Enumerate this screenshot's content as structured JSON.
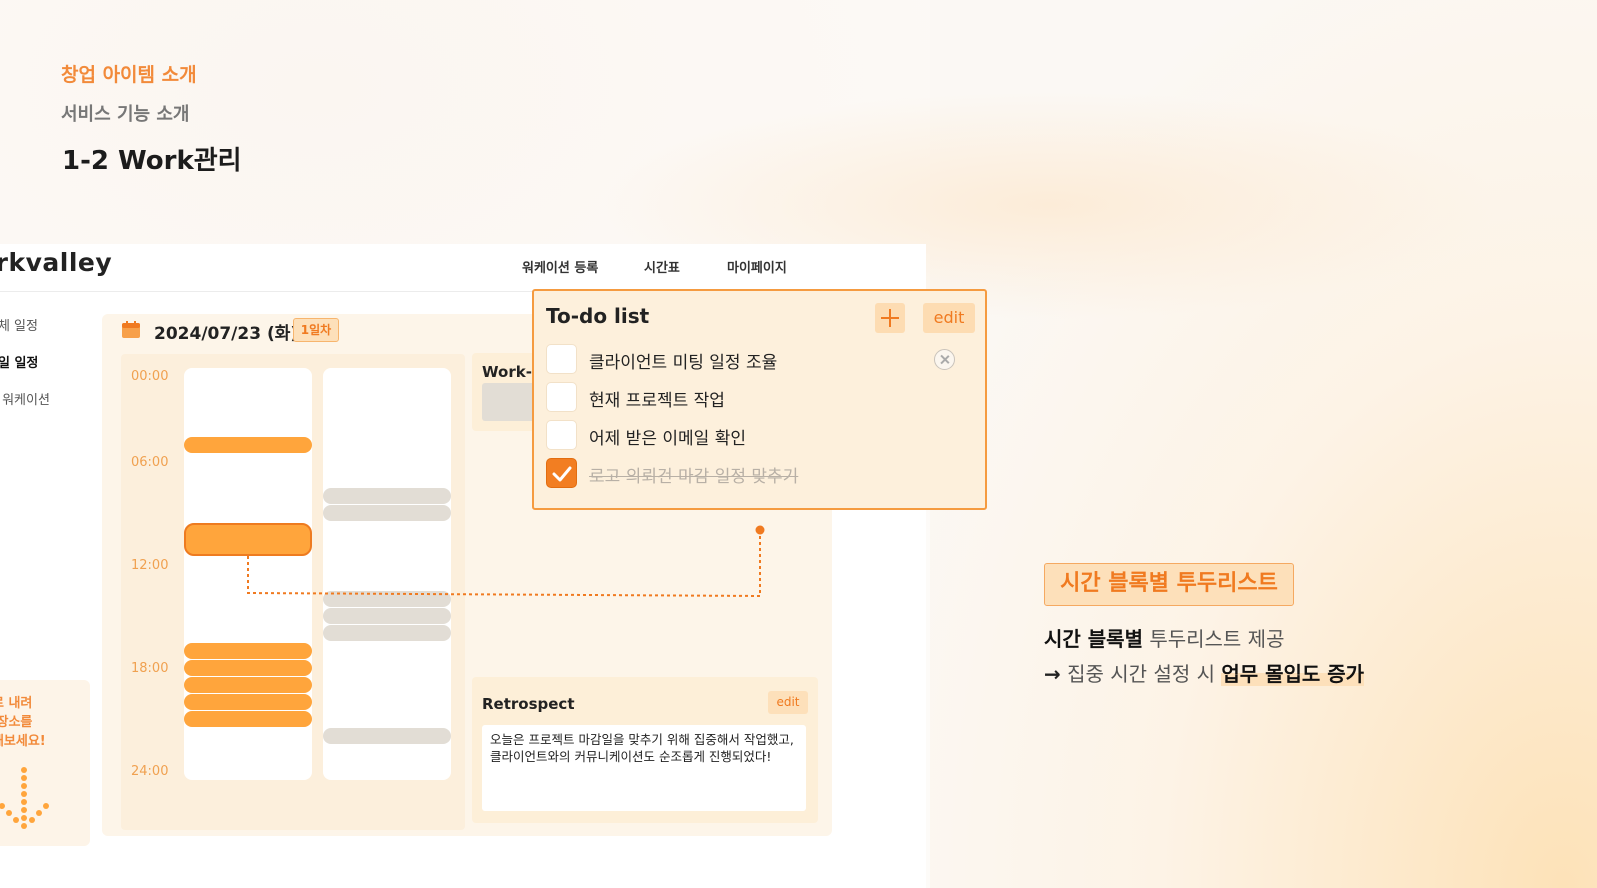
{
  "slide": {
    "kicker": "창업 아이템 소개",
    "section": "서비스 기능 소개",
    "title": "1-2 Work관리"
  },
  "app": {
    "brand": "orkvalley",
    "nav": [
      "워케이션 등록",
      "시간표",
      "마이페이지"
    ],
    "nav_active": "시간표",
    "sidebar": [
      "전체 일정",
      "일일 일정",
      "드 워케이션"
    ],
    "sidebar_active": "일일 일정",
    "banner_text": "으로 내려\n천 장소를\n인해보세요!",
    "date": "2024/07/23 (화)",
    "day_badge": "1일차",
    "time_labels": [
      "00:00",
      "06:00",
      "12:00",
      "18:00",
      "24:00"
    ],
    "work_card_title": "Work-F",
    "retrospect": {
      "title": "Retrospect",
      "edit_label": "edit",
      "text": "오늘은 프로젝트 마감일을 맞추기 위해 집중해서 작업했고, 클라이언트와의 커뮤니케이션도 순조롭게 진행되었다!"
    }
  },
  "todo": {
    "title": "To-do list",
    "edit_label": "edit",
    "items": [
      {
        "label": "클라이언트 미팅 일정 조율",
        "done": false
      },
      {
        "label": "현재 프로젝트 작업",
        "done": false
      },
      {
        "label": "어제 받은 이메일 확인",
        "done": false
      },
      {
        "label": "로고 의뢰건 마감 일정 맞추기",
        "done": true
      }
    ]
  },
  "feature": {
    "tag": "시간 블록별 투두리스트",
    "line1_bold": "시간 블록별",
    "line1_rest": " 투두리스트 제공",
    "line2_arrow": "→",
    "line2_text": " 집중 시간 설정 시 ",
    "line2_highlight": "업무 몰입도 증가"
  },
  "colors": {
    "accent": "#f07a20",
    "block_orange": "#ffa53c",
    "block_gray": "#e2ddd5",
    "panel": "#fdf5e9"
  }
}
